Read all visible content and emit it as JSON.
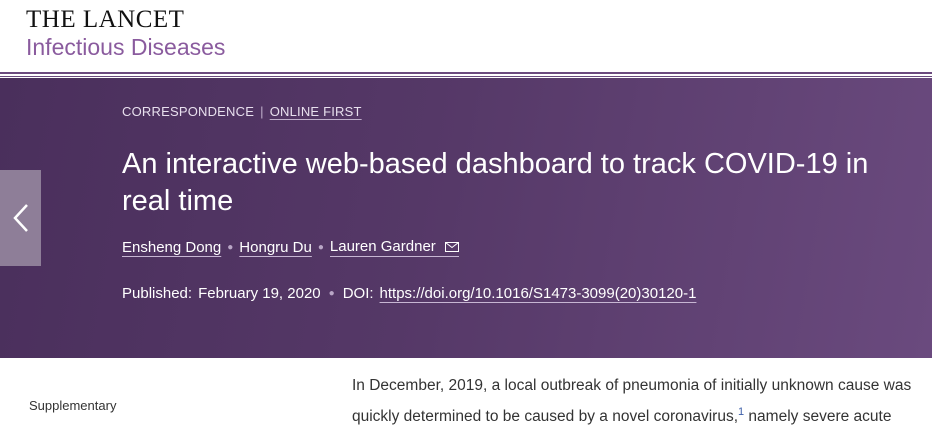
{
  "masthead": {
    "journal_line1": "THE LANCET",
    "journal_line2": "Infectious Diseases"
  },
  "article": {
    "article_type": "CORRESPONDENCE",
    "separator": "|",
    "status": "ONLINE FIRST",
    "title": "An interactive web-based dashboard to track COVID-19 in real time",
    "authors": [
      "Ensheng Dong",
      "Hongru Du",
      "Lauren Gardner"
    ],
    "published_label": "Published:",
    "published_date": "February 19, 2020",
    "doi_label": "DOI:",
    "doi": "https://doi.org/10.1016/S1473-3099(20)30120-1"
  },
  "sidebar": {
    "supplementary_label": "Supplementary"
  },
  "body": {
    "line1": "In December, 2019, a local outbreak of pneumonia of initially unknown cause was",
    "line2_pre": "quickly determined to be caused by a novel coronavirus,",
    "line2_ref": "1",
    "line2_post": " namely severe acute"
  },
  "icons": {
    "back": "chevron-left-icon",
    "mail": "envelope-icon"
  },
  "colors": {
    "banner": "#553867",
    "accent": "#8a5b9e",
    "back_tab": "#8e7e98"
  }
}
